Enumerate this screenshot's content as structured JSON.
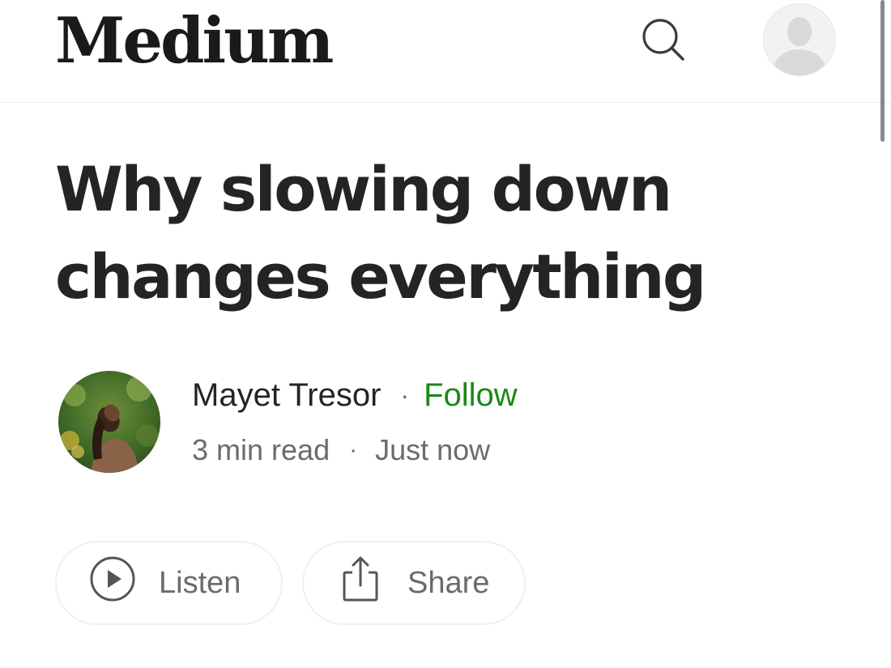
{
  "header": {
    "logo": "Medium",
    "icons": {
      "search": "search-icon",
      "profile": "user-avatar-icon"
    }
  },
  "article": {
    "title": "Why slowing down changes everything",
    "author": {
      "name": "Mayet Tresor",
      "separator": "·",
      "follow_label": "Follow",
      "avatar": "author-photo"
    },
    "meta": {
      "read_time": "3 min read",
      "separator": "·",
      "published": "Just now"
    }
  },
  "actions": {
    "listen_label": "Listen",
    "share_label": "Share",
    "icons": {
      "listen": "play-circle-icon",
      "share": "share-icon"
    }
  },
  "colors": {
    "text": "#242424",
    "muted": "#6b6b6b",
    "follow": "#1a8917",
    "divider": "#ececec"
  }
}
